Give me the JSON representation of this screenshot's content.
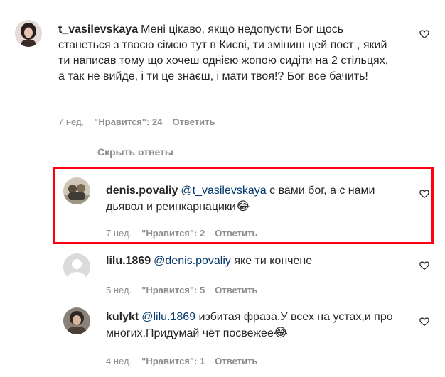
{
  "comments": [
    {
      "username": "t_vasilevskaya",
      "mention": "",
      "text": "Мені цікаво, якщо недопусти Бог щось станеться з твоєю сімєю тут в Києві, ти зміниш цей пост , який ти написав тому що хочеш однією жопою сидіти на 2 стільцях, а так не вийде, і ти це знаєш, і мати твоя!? Бог все бачить!",
      "emoji": "",
      "time": "7 нед.",
      "likes": "\"Нравится\": 24",
      "reply": "Ответить"
    },
    {
      "username": "denis.povaliy",
      "mention": "@t_vasilevskaya",
      "text": " с вами бог, а с нами дьявол и реинкарнацики",
      "emoji": "😂",
      "time": "7 нед.",
      "likes": "\"Нравится\": 2",
      "reply": "Ответить"
    },
    {
      "username": "lilu.1869",
      "mention": "@denis.povaliy",
      "text": " яке ти кончене",
      "emoji": "",
      "time": "5 нед.",
      "likes": "\"Нравится\": 5",
      "reply": "Ответить"
    },
    {
      "username": "kulykt",
      "mention": "@lilu.1869",
      "text": " избитая фраза.У всех на устах,и про многих.Придумай чёт посвежее",
      "emoji": "😂",
      "time": "4 нед.",
      "likes": "\"Нравится\": 1",
      "reply": "Ответить"
    }
  ],
  "hide_replies": "Скрыть ответы",
  "icons": {
    "like": "heart-icon"
  },
  "colors": {
    "highlight": "#ff0010",
    "mention": "#00376b",
    "meta": "#8e8e8e"
  }
}
